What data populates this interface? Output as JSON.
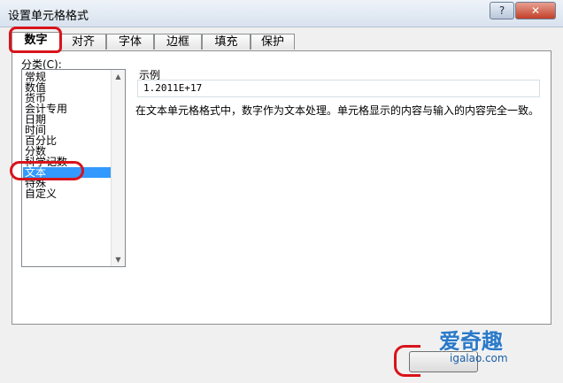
{
  "window": {
    "title": "设置单元格格式",
    "help_label": "?",
    "close_label": "✕"
  },
  "tabs": [
    {
      "label": "数字",
      "active": true
    },
    {
      "label": "对齐",
      "active": false
    },
    {
      "label": "字体",
      "active": false
    },
    {
      "label": "边框",
      "active": false
    },
    {
      "label": "填充",
      "active": false
    },
    {
      "label": "保护",
      "active": false
    }
  ],
  "category": {
    "label": "分类(C):",
    "items": [
      "常规",
      "数值",
      "货币",
      "会计专用",
      "日期",
      "时间",
      "百分比",
      "分数",
      "科学记数",
      "文本",
      "特殊",
      "自定义"
    ],
    "selected_index": 9
  },
  "sample": {
    "label": "示例",
    "value": "1.2011E+17"
  },
  "description": "在文本单元格格式中，数字作为文本处理。单元格显示的内容与输入的内容完全一致。",
  "watermark": {
    "text": "爱奇趣",
    "url": "igalao.com"
  },
  "annotation_color": "#d8141b"
}
